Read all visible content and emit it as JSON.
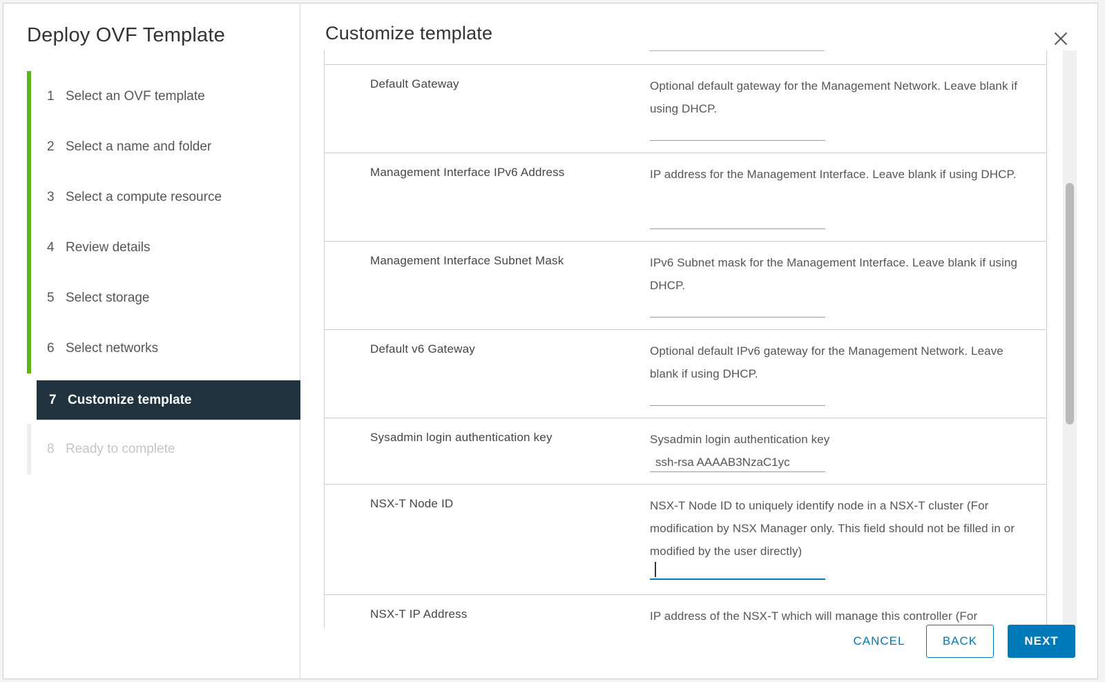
{
  "dialog": {
    "title": "Deploy OVF Template"
  },
  "steps": [
    {
      "num": "1",
      "label": "Select an OVF template",
      "state": "done"
    },
    {
      "num": "2",
      "label": "Select a name and folder",
      "state": "done"
    },
    {
      "num": "3",
      "label": "Select a compute resource",
      "state": "done"
    },
    {
      "num": "4",
      "label": "Review details",
      "state": "done"
    },
    {
      "num": "5",
      "label": "Select storage",
      "state": "done"
    },
    {
      "num": "6",
      "label": "Select networks",
      "state": "done"
    },
    {
      "num": "7",
      "label": "Customize template",
      "state": "active"
    },
    {
      "num": "8",
      "label": "Ready to complete",
      "state": "disabled"
    }
  ],
  "content": {
    "title": "Customize template"
  },
  "rows": [
    {
      "label": "Default Gateway",
      "description": "Optional default gateway for the Management Network. Leave blank if using DHCP.",
      "value": ""
    },
    {
      "label": "Management Interface IPv6 Address",
      "description": "IP address for the Management Interface. Leave blank if using DHCP.",
      "value": ""
    },
    {
      "label": "Management Interface Subnet Mask",
      "description": "IPv6 Subnet mask for the Management Interface. Leave blank if using DHCP.",
      "value": ""
    },
    {
      "label": "Default v6 Gateway",
      "description": "Optional default IPv6 gateway for the Management Network. Leave blank if using DHCP.",
      "value": ""
    },
    {
      "label": "Sysadmin login authentication key",
      "description": "Sysadmin login authentication key",
      "value": "ssh-rsa AAAAB3NzaC1yc"
    },
    {
      "label": "NSX-T Node ID",
      "description": "NSX-T Node ID to uniquely identify node in a NSX-T cluster (For modification by NSX Manager only. This field should not be filled in or modified by the user directly)",
      "value": ""
    },
    {
      "label": "NSX-T IP Address",
      "description": "IP address of the NSX-T which will manage this controller (For",
      "value": ""
    }
  ],
  "footer": {
    "cancel_label": "CANCEL",
    "back_label": "BACK",
    "next_label": "NEXT"
  },
  "colors": {
    "step_done": "#60b515",
    "step_active_bg": "#21333f",
    "primary": "#0079b8"
  },
  "icons": {
    "close": "close-icon"
  }
}
